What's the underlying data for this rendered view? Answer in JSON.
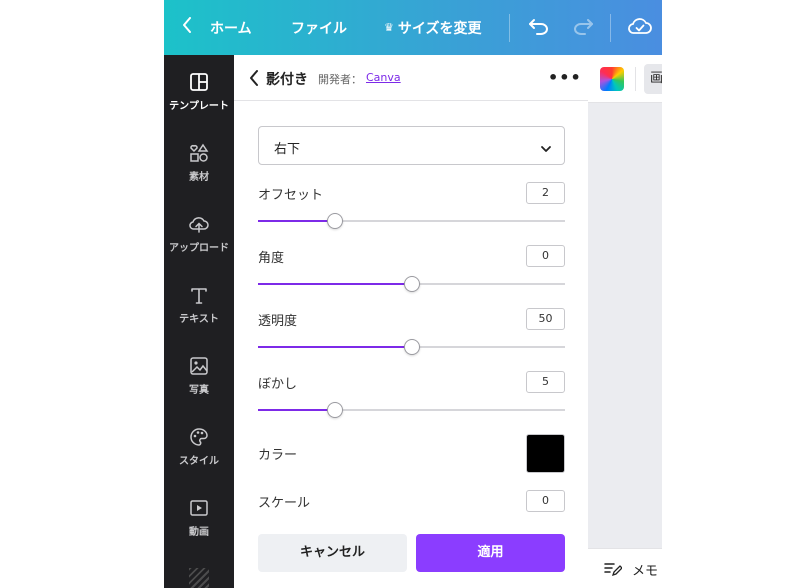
{
  "topbar": {
    "home_label": "ホーム",
    "file_label": "ファイル",
    "resize_label": "サイズを変更",
    "icons": [
      "chevron-left-icon",
      "crown-icon",
      "undo-icon",
      "redo-icon",
      "cloud-check-icon"
    ]
  },
  "sidebar": {
    "items": [
      {
        "label": "テンプレート",
        "icon": "template-icon",
        "active": true
      },
      {
        "label": "素材",
        "icon": "elements-icon",
        "active": false
      },
      {
        "label": "アップロード",
        "icon": "upload-icon",
        "active": false
      },
      {
        "label": "テキスト",
        "icon": "text-icon",
        "active": false
      },
      {
        "label": "写真",
        "icon": "photo-icon",
        "active": false
      },
      {
        "label": "スタイル",
        "icon": "palette-icon",
        "active": false
      },
      {
        "label": "動画",
        "icon": "video-icon",
        "active": false
      }
    ]
  },
  "panel": {
    "title": "影付き",
    "developer_label": "開発者：",
    "developer_link": "Canva",
    "direction_value": "右下",
    "offset": {
      "label": "オフセット",
      "value": "2",
      "fraction": 0.25
    },
    "angle": {
      "label": "角度",
      "value": "0",
      "fraction": 0.5
    },
    "transparency": {
      "label": "透明度",
      "value": "50",
      "fraction": 0.5
    },
    "blur": {
      "label": "ぼかし",
      "value": "5",
      "fraction": 0.25
    },
    "color": {
      "label": "カラー",
      "value": "#000000"
    },
    "scale": {
      "label": "スケール",
      "value": "0"
    },
    "cancel_label": "キャンセル",
    "apply_label": "適用"
  },
  "canvas": {
    "image_button_label": "画",
    "notes_label": "メモ"
  },
  "colors": {
    "accent": "#8b3dff",
    "slider_fill": "#7d2ae8",
    "sidebar_bg": "#1f1f22",
    "topbar_gradient_start": "#1cc2c9",
    "topbar_gradient_end": "#4a8ee0"
  }
}
